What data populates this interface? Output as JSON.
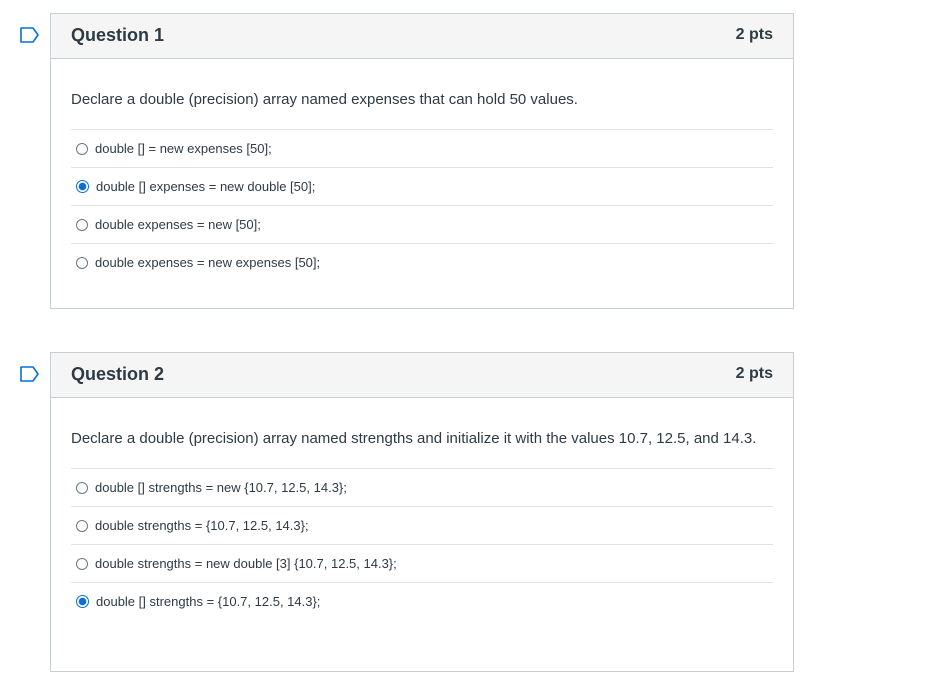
{
  "questions": [
    {
      "title": "Question 1",
      "points": "2 pts",
      "text": "Declare a double (precision) array named expenses that can hold 50 values.",
      "answers": [
        {
          "label": "double [] = new expenses [50];",
          "selected": false
        },
        {
          "label": "double [] expenses = new double [50];",
          "selected": true
        },
        {
          "label": "double expenses = new [50];",
          "selected": false
        },
        {
          "label": "double expenses = new expenses [50];",
          "selected": false
        }
      ]
    },
    {
      "title": "Question 2",
      "points": "2 pts",
      "text": "Declare a double (precision) array named strengths and initialize it with the values 10.7, 12.5, and 14.3.",
      "answers": [
        {
          "label": "double [] strengths = new {10.7, 12.5, 14.3};",
          "selected": false
        },
        {
          "label": "double strengths = {10.7, 12.5, 14.3};",
          "selected": false
        },
        {
          "label": "double strengths = new double [3] {10.7, 12.5, 14.3};",
          "selected": false
        },
        {
          "label": "double [] strengths = {10.7, 12.5, 14.3};",
          "selected": true
        }
      ]
    }
  ],
  "colors": {
    "accent": "#0770d6",
    "header_bg": "#f5f5f5",
    "border": "#c7cdd1",
    "text": "#2d3b45"
  },
  "icons": {
    "flag": "flag-question-icon"
  }
}
